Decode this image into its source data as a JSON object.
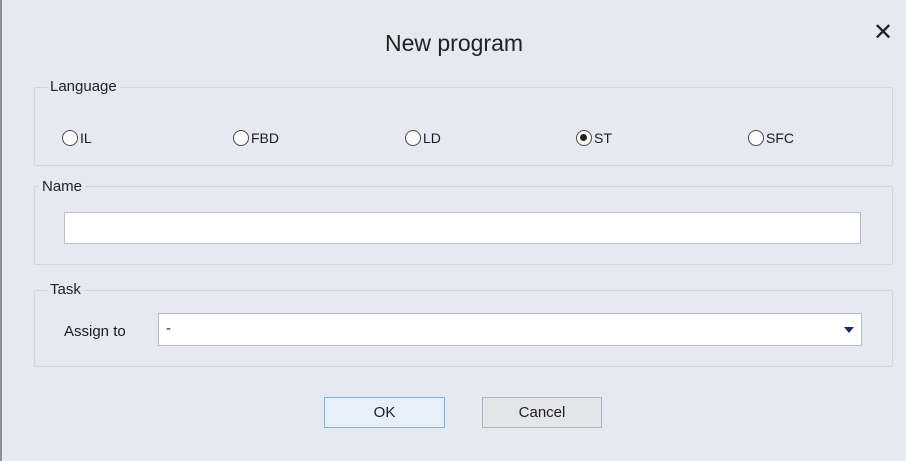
{
  "dialog": {
    "title": "New program",
    "close_glyph": "✕"
  },
  "language_group": {
    "label": "Language",
    "options": [
      {
        "label": "IL",
        "checked": false
      },
      {
        "label": "FBD",
        "checked": false
      },
      {
        "label": "LD",
        "checked": false
      },
      {
        "label": "ST",
        "checked": true
      },
      {
        "label": "SFC",
        "checked": false
      }
    ],
    "selected": "ST"
  },
  "name_group": {
    "label": "Name",
    "value": "",
    "placeholder": ""
  },
  "task_group": {
    "label": "Task",
    "assign_label": "Assign to",
    "assign_value": "-"
  },
  "buttons": {
    "ok_label": "OK",
    "cancel_label": "Cancel"
  },
  "colors": {
    "background": "#e6e8f2",
    "ok_border": "#7fb1e1",
    "ok_background": "#e6f0fb",
    "dropdown_arrow": "#1a2a66"
  }
}
